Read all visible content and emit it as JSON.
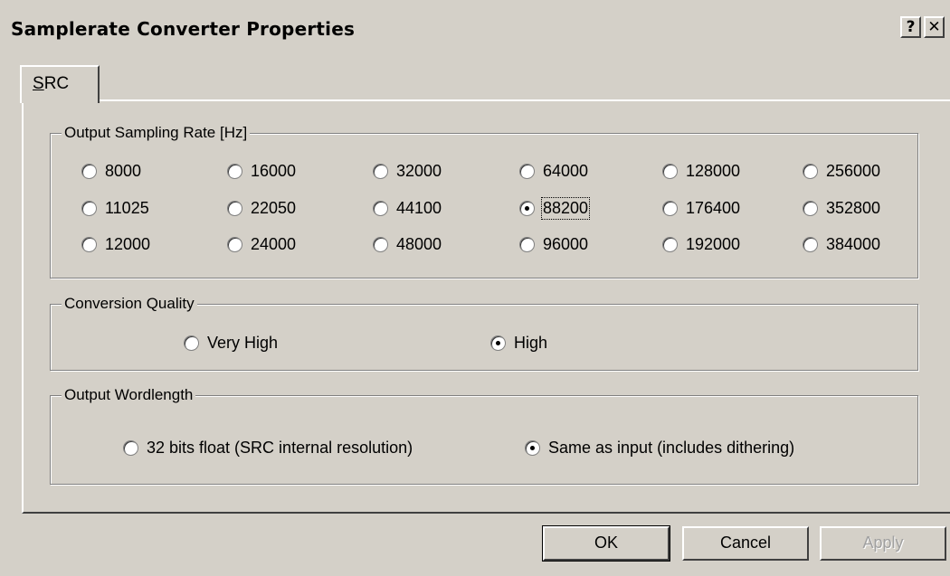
{
  "window": {
    "title": "Samplerate Converter Properties",
    "help_glyph": "?",
    "close_glyph": "✕"
  },
  "tabs": [
    {
      "label_underlined": "S",
      "label_rest": "RC",
      "active": true
    }
  ],
  "sampling": {
    "title": "Output Sampling Rate [Hz]",
    "rates": [
      [
        "8000",
        "16000",
        "32000",
        "64000",
        "128000",
        "256000"
      ],
      [
        "11025",
        "22050",
        "44100",
        "88200",
        "176400",
        "352800"
      ],
      [
        "12000",
        "24000",
        "48000",
        "96000",
        "192000",
        "384000"
      ]
    ],
    "selected": "88200"
  },
  "quality": {
    "title": "Conversion Quality",
    "options": [
      "Very High",
      "High"
    ],
    "selected": "High"
  },
  "wordlength": {
    "title": "Output Wordlength",
    "options": [
      "32 bits float (SRC internal resolution)",
      "Same as input (includes dithering)"
    ],
    "selected": "Same as input (includes dithering)"
  },
  "buttons": {
    "ok": "OK",
    "cancel": "Cancel",
    "apply": "Apply"
  }
}
